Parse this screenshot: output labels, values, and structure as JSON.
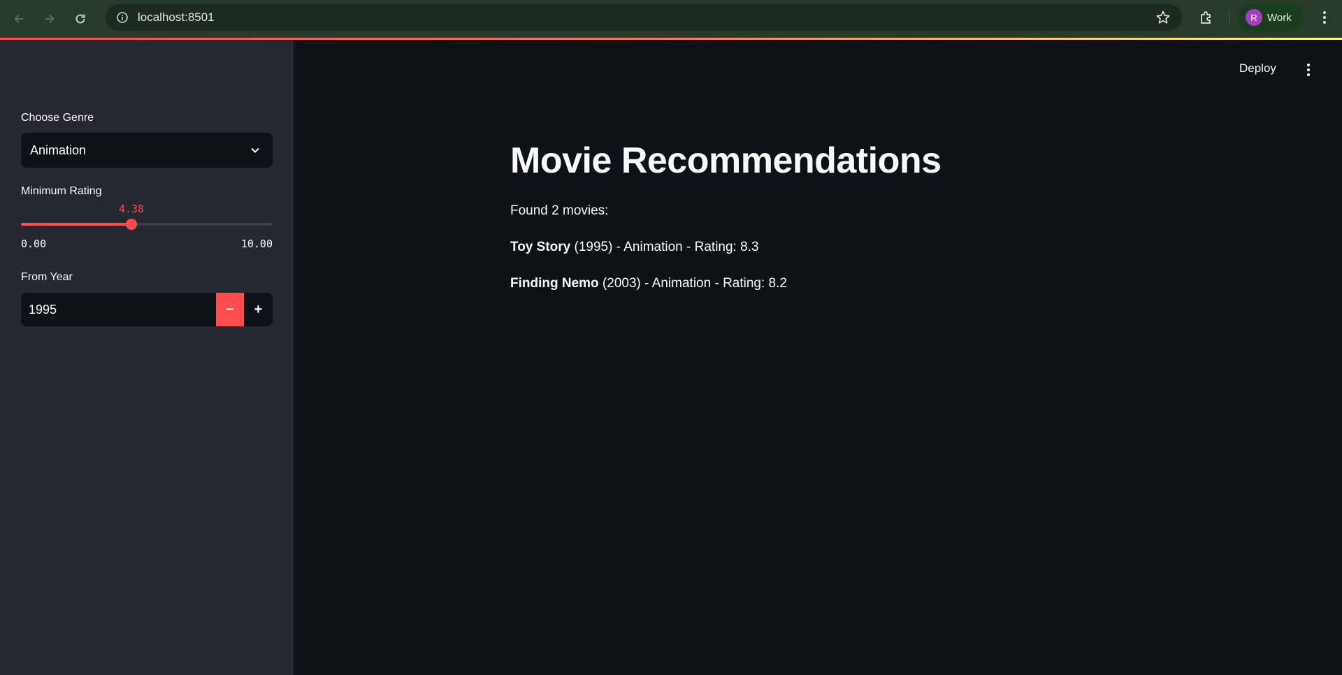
{
  "browser": {
    "url": "localhost:8501",
    "profile": {
      "initial": "R",
      "label": "Work"
    }
  },
  "toolbar": {
    "deploy_label": "Deploy"
  },
  "sidebar": {
    "genre": {
      "label": "Choose Genre",
      "value": "Animation"
    },
    "rating": {
      "label": "Minimum Rating",
      "value": "4.38",
      "value_number": 4.38,
      "min": "0.00",
      "max": "10.00",
      "min_number": 0,
      "max_number": 10
    },
    "year": {
      "label": "From Year",
      "value": "1995",
      "minus": "−",
      "plus": "+"
    }
  },
  "main": {
    "title": "Movie Recommendations",
    "found": "Found 2 movies:",
    "movies": [
      {
        "title": "Toy Story",
        "details": " (1995) - Animation - Rating: 8.3"
      },
      {
        "title": "Finding Nemo",
        "details": " (2003) - Animation - Rating: 8.2"
      }
    ]
  },
  "colors": {
    "accent": "#ff4b4b",
    "sidebar_bg": "#262730",
    "main_bg": "#0e1117"
  },
  "icons": [
    "back-icon",
    "forward-icon",
    "reload-icon",
    "info-icon",
    "star-icon",
    "extensions-icon",
    "chrome-menu-icon",
    "chevron-down-icon",
    "app-menu-icon"
  ]
}
